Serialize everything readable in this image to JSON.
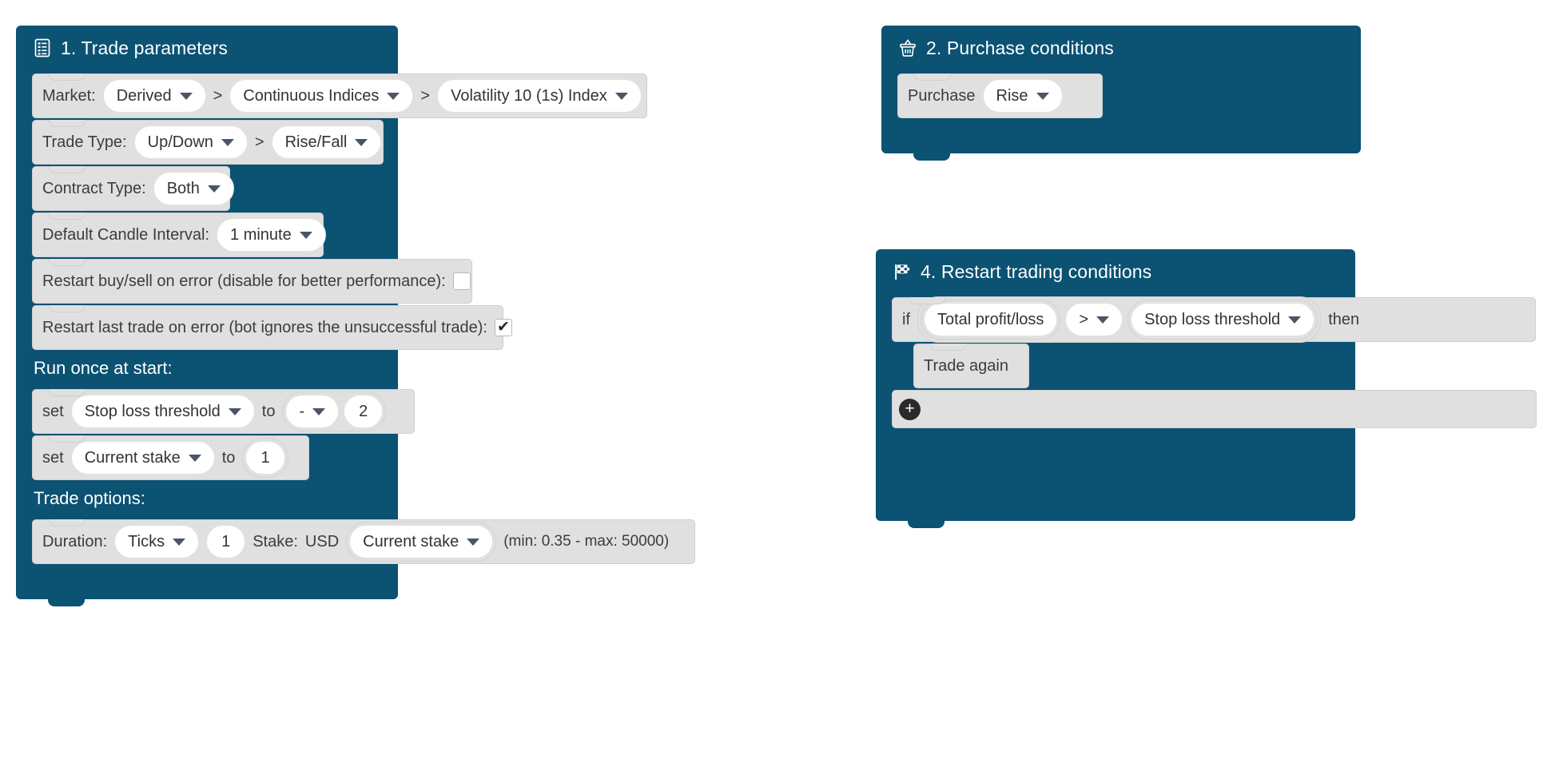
{
  "theme": {
    "container_blue": "#0b5273",
    "statement_grey": "#e0e0e0",
    "field_white": "#ffffff",
    "text_dark": "#3c3c3c",
    "caret_color": "#4a5568",
    "plus_button": "#2a2a2a"
  },
  "blocks": {
    "trade_parameters": {
      "icon": "document-list-icon",
      "title": "1. Trade parameters",
      "market": {
        "label": "Market:",
        "separator": ">",
        "level1": "Derived",
        "level2": "Continuous Indices",
        "level3": "Volatility 10 (1s) Index"
      },
      "trade_type": {
        "label": "Trade Type:",
        "separator": ">",
        "level1": "Up/Down",
        "level2": "Rise/Fall"
      },
      "contract_type": {
        "label": "Contract Type:",
        "value": "Both"
      },
      "candle_interval": {
        "label": "Default Candle Interval:",
        "value": "1 minute"
      },
      "restart_buy_sell": {
        "label": "Restart buy/sell on error (disable for better performance):",
        "checked": false,
        "tick": ""
      },
      "restart_last_trade": {
        "label": "Restart last trade on error (bot ignores the unsuccessful trade):",
        "checked": true,
        "tick": "✔"
      },
      "run_once": {
        "title": "Run once at start:",
        "rows": [
          {
            "set_label": "set",
            "variable": "Stop loss threshold",
            "to_label": "to",
            "operator": "-",
            "value": "2"
          },
          {
            "set_label": "set",
            "variable": "Current stake",
            "to_label": "to",
            "value": "1"
          }
        ]
      },
      "trade_options": {
        "title": "Trade options:",
        "duration_label": "Duration:",
        "duration_unit": "Ticks",
        "duration_value": "1",
        "stake_label": "Stake:",
        "currency": "USD",
        "stake_variable": "Current stake",
        "limits": "(min: 0.35 - max: 50000)"
      }
    },
    "purchase_conditions": {
      "icon": "shopping-basket-icon",
      "title": "2. Purchase conditions",
      "purchase_label": "Purchase",
      "purchase_value": "Rise"
    },
    "restart_trading": {
      "icon": "checkered-flag-icon",
      "title": "4. Restart trading conditions",
      "if_label": "if",
      "left_operand": "Total profit/loss",
      "operator": ">",
      "right_operand": "Stop loss threshold",
      "then_label": "then",
      "body_statement": "Trade again",
      "add_label": "+"
    }
  }
}
